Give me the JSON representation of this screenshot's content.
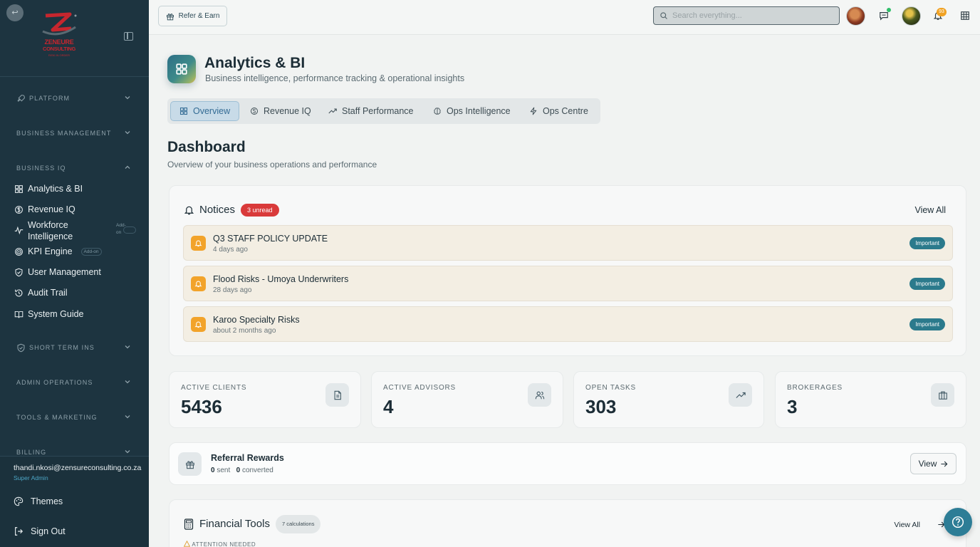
{
  "brand": {
    "logo_line1": "ZENEURE",
    "logo_line2": "CONSULTING",
    "logo_line3": "RISK IN ORDER"
  },
  "sidebar": {
    "sections": {
      "platform": "PLATFORM",
      "business_management": "BUSINESS MANAGEMENT",
      "business_iq": "BUSINESS IQ",
      "short_term_ins": "SHORT TERM INS",
      "admin_operations": "ADMIN OPERATIONS",
      "tools_marketing": "TOOLS & MARKETING",
      "billing": "BILLING"
    },
    "items": [
      {
        "label": "Analytics & BI",
        "icon": "grid-icon"
      },
      {
        "label": "Revenue IQ",
        "icon": "dollar-circle-icon"
      },
      {
        "label": "Workforce",
        "label2": "Intelligence",
        "icon": "pulse-icon",
        "addon": "Add-on"
      },
      {
        "label": "KPI Engine",
        "icon": "target-icon",
        "addon": "Add-on"
      },
      {
        "label": "User Management",
        "icon": "shield-check-icon"
      },
      {
        "label": "Audit Trail",
        "icon": "history-icon"
      },
      {
        "label": "System Guide",
        "icon": "book-icon"
      }
    ],
    "user": {
      "email": "thandi.nkosi@zensureconsulting.co.za",
      "role": "Super Admin"
    },
    "themes_label": "Themes",
    "signout_label": "Sign Out"
  },
  "header": {
    "refer_label": "Refer & Earn",
    "search_placeholder": "Search everything...",
    "notification_count": "93"
  },
  "page": {
    "title": "Analytics & BI",
    "subtitle": "Business intelligence, performance tracking & operational insights"
  },
  "tabs": [
    {
      "label": "Overview",
      "icon": "grid-icon",
      "active": true
    },
    {
      "label": "Revenue IQ",
      "icon": "dollar-circle-icon"
    },
    {
      "label": "Staff Performance",
      "icon": "trending-up-icon"
    },
    {
      "label": "Ops Intelligence",
      "icon": "brain-icon"
    },
    {
      "label": "Ops Centre",
      "icon": "zap-icon"
    }
  ],
  "dashboard": {
    "title": "Dashboard",
    "subtitle": "Overview of your business operations and performance"
  },
  "notices": {
    "title": "Notices",
    "unread_badge": "3 unread",
    "view_all": "View All",
    "items": [
      {
        "title": "Q3 STAFF POLICY UPDATE",
        "date": "4 days ago",
        "tag": "Important"
      },
      {
        "title": "Flood Risks - Umoya Underwriters",
        "date": "28 days ago",
        "tag": "Important"
      },
      {
        "title": "Karoo Specialty Risks",
        "date": "about 2 months ago",
        "tag": "Important"
      }
    ]
  },
  "stats": [
    {
      "label": "ACTIVE CLIENTS",
      "value": "5436",
      "icon": "document-icon"
    },
    {
      "label": "ACTIVE ADVISORS",
      "value": "4",
      "icon": "users-icon"
    },
    {
      "label": "OPEN TASKS",
      "value": "303",
      "icon": "trending-up-icon"
    },
    {
      "label": "BROKERAGES",
      "value": "3",
      "icon": "building-icon"
    }
  ],
  "referral": {
    "title": "Referral Rewards",
    "sent_count": "0",
    "sent_label": "sent",
    "converted_count": "0",
    "converted_label": "converted",
    "view_label": "View"
  },
  "financial_tools": {
    "title": "Financial Tools",
    "badge": "7 calculations",
    "view_all": "View All",
    "attention": "ATTENTION NEEDED"
  },
  "colors": {
    "sidebar_bg": "#1d3440",
    "accent": "#2d7d96",
    "danger": "#d93a3a",
    "warning": "#f2a32a"
  }
}
